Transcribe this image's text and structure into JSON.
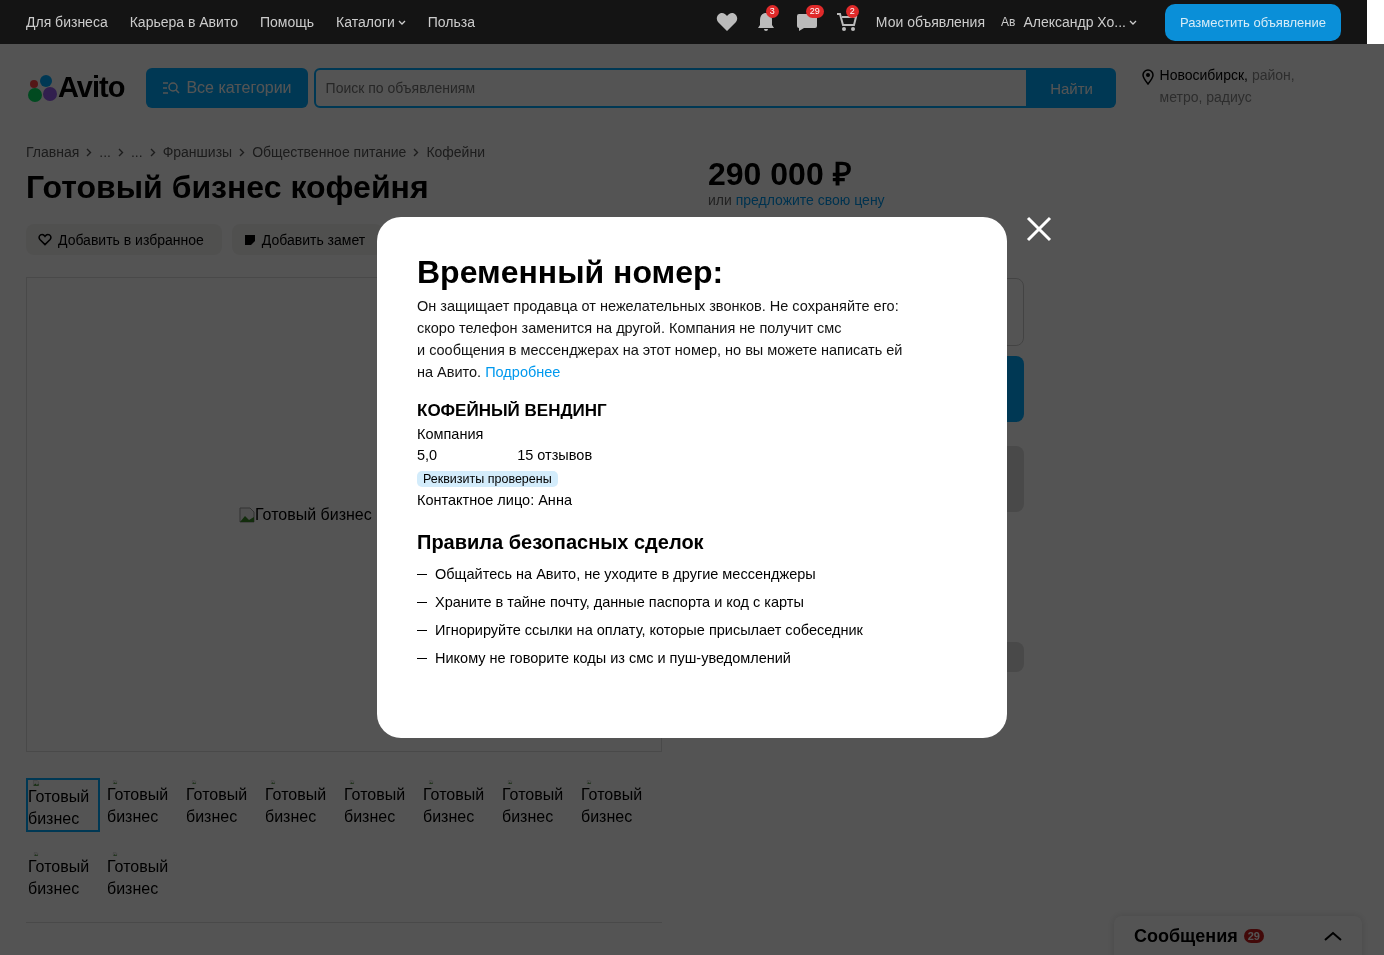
{
  "topbar": {
    "links": [
      {
        "label": "Для бизнеса",
        "caret": false
      },
      {
        "label": "Карьера в Авито",
        "caret": false
      },
      {
        "label": "Помощь",
        "caret": false
      },
      {
        "label": "Каталоги",
        "caret": true
      },
      {
        "label": "Польза",
        "caret": false
      }
    ],
    "icons": [
      {
        "kind": "heart"
      },
      {
        "kind": "bell",
        "badge": "3"
      },
      {
        "kind": "chat",
        "badge": "29"
      },
      {
        "kind": "cart",
        "badge": "2"
      }
    ],
    "my_ads": "Мои объявления",
    "avatar_alt": "Ав",
    "user": "Александр Хо...",
    "post_button": "Разместить объявление"
  },
  "searchbar": {
    "logo": "Avito",
    "categories": "Все категории",
    "placeholder": "Поиск по объявлениям",
    "find": "Найти",
    "city": "Новосибирск,",
    "location_hint": "район, метро, радиус"
  },
  "breadcrumbs": [
    "Главная",
    "...",
    "...",
    "Франшизы",
    "Общественное питание",
    "Кофейни"
  ],
  "title": "Готовый бизнес кофейня",
  "actions": [
    {
      "kind": "favorite",
      "label": "Добавить в избранное"
    },
    {
      "kind": "note",
      "label": "Добавить замет"
    }
  ],
  "main_image_alt": "Готовый бизнес",
  "thumbnails": [
    {
      "alt": "Готовый бизнес",
      "selected": true
    },
    {
      "alt": "Готовый бизнес",
      "selected": false
    },
    {
      "alt": "Готовый бизнес",
      "selected": false
    },
    {
      "alt": "Готовый бизнес",
      "selected": false
    },
    {
      "alt": "Готовый бизнес",
      "selected": false
    },
    {
      "alt": "Готовый бизнес",
      "selected": false
    },
    {
      "alt": "Готовый бизнес",
      "selected": false
    },
    {
      "alt": "Готовый бизнес",
      "selected": false
    },
    {
      "alt": "Готовый бизнес",
      "selected": false
    },
    {
      "alt": "Готовый бизнес",
      "selected": false
    }
  ],
  "price": {
    "amount": "290 000 ₽",
    "offer_prefix": "или",
    "offer_link": "предложите свою цену"
  },
  "messages": {
    "label": "Сообщения",
    "badge": "29"
  },
  "modal": {
    "title": "Временный номер:",
    "text": "Он защищает продавца от нежелательных звонков. Не сохраняйте его:\nскоро телефон заменится на другой. Компания не получит смс\nи сообщения в мессенджерах на этот номер, но вы можете написать ей\nна Авито. ",
    "link": "Подробнее",
    "seller": {
      "name": "КОФЕЙНЫЙ ВЕНДИНГ",
      "type": "Компания",
      "rating": "5,0",
      "reviews": "15 отзывов",
      "badge": "Реквизиты проверены",
      "contact": "Контактное лицо: Анна"
    },
    "rules_title": "Правила безопасных сделок",
    "rules": [
      "Общайтесь на Авито, не уходите в другие мессенджеры",
      "Храните в тайне почту, данные паспорта и код с карты",
      "Игнорируйте ссылки на оплату, которые присылает собеседник",
      "Никому не говорите коды из смс и пуш-уведомлений"
    ]
  }
}
